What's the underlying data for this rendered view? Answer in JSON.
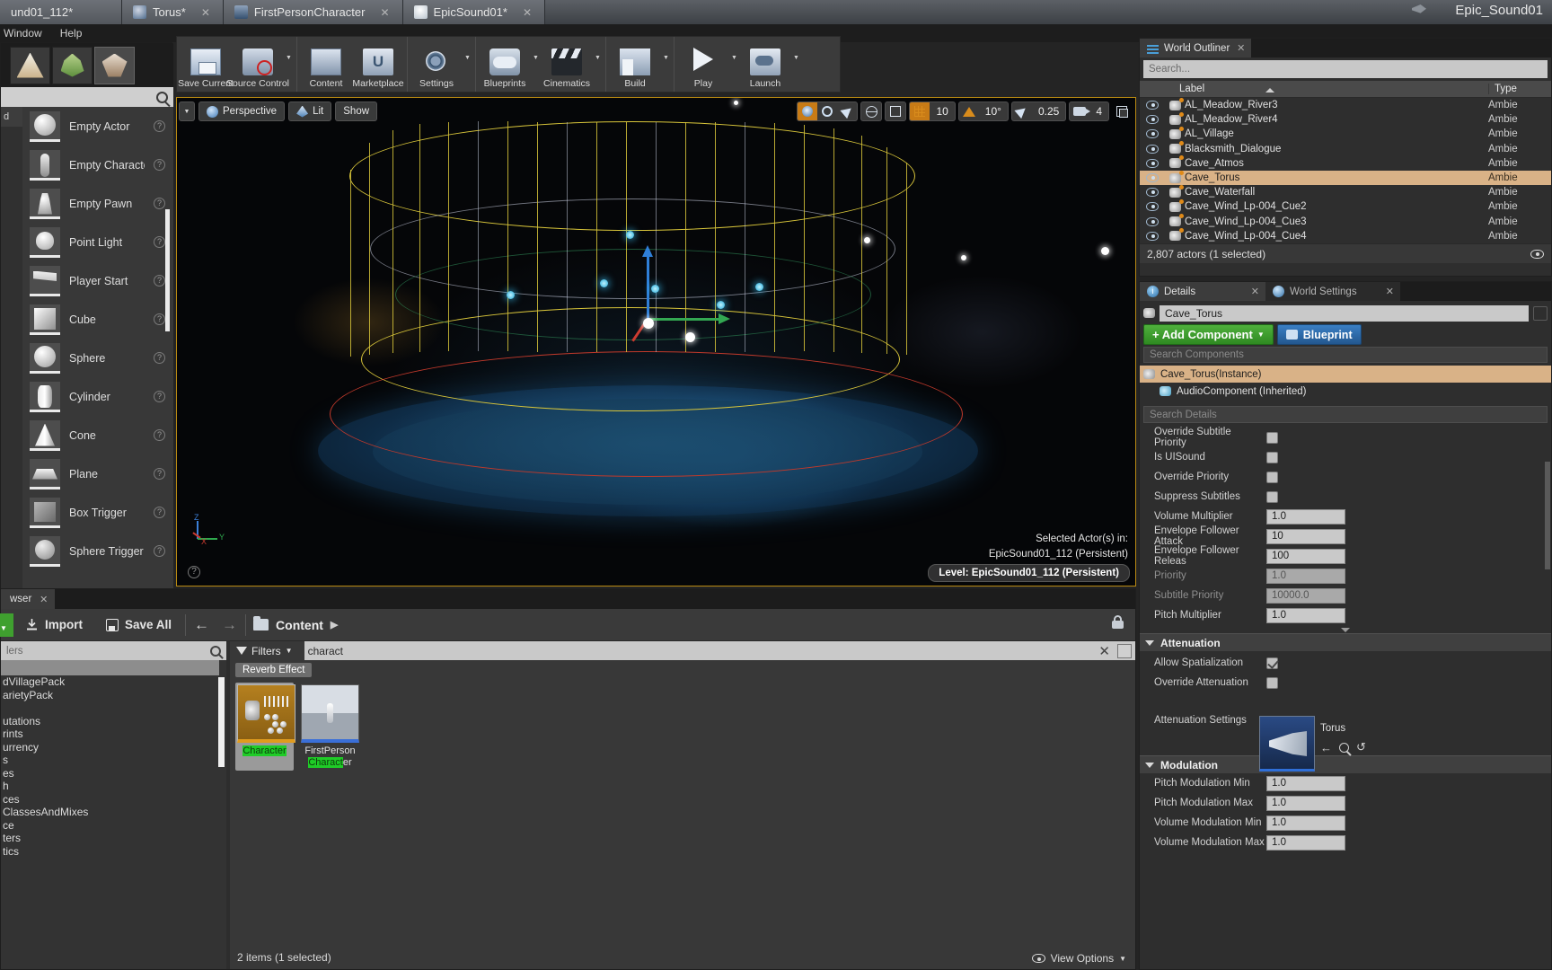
{
  "window": {
    "tabs": [
      {
        "label": "und01_112*",
        "icon": "level-icon",
        "closable": false
      },
      {
        "label": "Torus*",
        "icon": "torus-icon",
        "closable": true
      },
      {
        "label": "FirstPersonCharacter",
        "icon": "character-icon",
        "closable": true
      },
      {
        "label": "EpicSound01*",
        "icon": "sound-icon",
        "closable": true
      }
    ],
    "app_title": "Epic_Sound01"
  },
  "menubar": {
    "items": [
      "Window",
      "Help"
    ]
  },
  "toolbar": {
    "groups": [
      {
        "buttons": [
          {
            "label": "Save Current",
            "icon": "save-icon",
            "dropdown": false
          },
          {
            "label": "Source Control",
            "icon": "source-control-icon",
            "dropdown": true
          }
        ]
      },
      {
        "buttons": [
          {
            "label": "Content",
            "icon": "content-icon",
            "dropdown": false
          },
          {
            "label": "Marketplace",
            "icon": "marketplace-icon",
            "dropdown": false
          }
        ]
      },
      {
        "buttons": [
          {
            "label": "Settings",
            "icon": "settings-gear-icon",
            "dropdown": true
          }
        ]
      },
      {
        "buttons": [
          {
            "label": "Blueprints",
            "icon": "blueprints-icon",
            "dropdown": true
          },
          {
            "label": "Cinematics",
            "icon": "cinematics-icon",
            "dropdown": true
          }
        ]
      },
      {
        "buttons": [
          {
            "label": "Build",
            "icon": "build-icon",
            "dropdown": true
          }
        ]
      },
      {
        "buttons": [
          {
            "label": "Play",
            "icon": "play-icon",
            "dropdown": true
          },
          {
            "label": "Launch",
            "icon": "launch-icon",
            "dropdown": true
          }
        ]
      }
    ]
  },
  "place_actors": {
    "search_placeholder": "",
    "category_label": "d",
    "items": [
      {
        "label": "Empty Actor",
        "icon": "sphere-thumb"
      },
      {
        "label": "Empty Character",
        "icon": "character-thumb"
      },
      {
        "label": "Empty Pawn",
        "icon": "pawn-thumb"
      },
      {
        "label": "Point Light",
        "icon": "bulb-thumb"
      },
      {
        "label": "Player Start",
        "icon": "flag-thumb"
      },
      {
        "label": "Cube",
        "icon": "cube-thumb"
      },
      {
        "label": "Sphere",
        "icon": "sphere-thumb"
      },
      {
        "label": "Cylinder",
        "icon": "cylinder-thumb"
      },
      {
        "label": "Cone",
        "icon": "cone-thumb"
      },
      {
        "label": "Plane",
        "icon": "plane-thumb"
      },
      {
        "label": "Box Trigger",
        "icon": "box-trigger-thumb"
      },
      {
        "label": "Sphere Trigger",
        "icon": "sphere-trigger-thumb"
      }
    ]
  },
  "viewport": {
    "perspective_label": "Perspective",
    "view_mode_label": "Lit",
    "show_label": "Show",
    "grid_snap_value": "10",
    "rotation_snap_value": "10°",
    "scale_snap_value": "0.25",
    "camera_speed_value": "4",
    "overlay_line1": "Selected Actor(s) in:",
    "overlay_line2": "EpicSound01_112 (Persistent)",
    "level_chip": "Level:  EpicSound01_112 (Persistent)",
    "axis_labels": {
      "x": "X",
      "y": "Y",
      "z": "Z"
    }
  },
  "outliner": {
    "title": "World Outliner",
    "search_placeholder": "Search...",
    "columns": [
      "Label",
      "Type"
    ],
    "rows": [
      {
        "label": "AL_Meadow_River3",
        "type": "Ambie",
        "selected": false
      },
      {
        "label": "AL_Meadow_River4",
        "type": "Ambie",
        "selected": false
      },
      {
        "label": "AL_Village",
        "type": "Ambie",
        "selected": false
      },
      {
        "label": "Blacksmith_Dialogue",
        "type": "Ambie",
        "selected": false
      },
      {
        "label": "Cave_Atmos",
        "type": "Ambie",
        "selected": false
      },
      {
        "label": "Cave_Torus",
        "type": "Ambie",
        "selected": true
      },
      {
        "label": "Cave_Waterfall",
        "type": "Ambie",
        "selected": false
      },
      {
        "label": "Cave_Wind_Lp-004_Cue2",
        "type": "Ambie",
        "selected": false
      },
      {
        "label": "Cave_Wind_Lp-004_Cue3",
        "type": "Ambie",
        "selected": false
      },
      {
        "label": "Cave_Wind_Lp-004_Cue4",
        "type": "Ambie",
        "selected": false
      }
    ],
    "status": "2,807 actors (1 selected)"
  },
  "details": {
    "tab_title": "Details",
    "world_settings_tab": "World Settings",
    "actor_name": "Cave_Torus",
    "add_component_label": "+ Add Component",
    "blueprint_label": "Blueprint",
    "search_components_placeholder": "Search Components",
    "components": [
      {
        "label": "Cave_Torus(Instance)",
        "selected": true,
        "indent": false
      },
      {
        "label": "AudioComponent (Inherited)",
        "selected": false,
        "indent": true
      }
    ],
    "search_details_placeholder": "Search Details",
    "properties": [
      {
        "label": "Override Subtitle Priority",
        "type": "checkbox",
        "value": false,
        "disabled": false
      },
      {
        "label": "Is UISound",
        "type": "checkbox",
        "value": false,
        "disabled": false
      },
      {
        "label": "Override Priority",
        "type": "checkbox",
        "value": false,
        "disabled": false
      },
      {
        "label": "Suppress Subtitles",
        "type": "checkbox",
        "value": false,
        "disabled": false
      },
      {
        "label": "Volume Multiplier",
        "type": "number",
        "value": "1.0",
        "disabled": false
      },
      {
        "label": "Envelope Follower Attack",
        "type": "number",
        "value": "10",
        "disabled": false
      },
      {
        "label": "Envelope Follower Releas",
        "type": "number",
        "value": "100",
        "disabled": false
      },
      {
        "label": "Priority",
        "type": "number",
        "value": "1.0",
        "disabled": true
      },
      {
        "label": "Subtitle Priority",
        "type": "number",
        "value": "10000.0",
        "disabled": true
      },
      {
        "label": "Pitch Multiplier",
        "type": "number",
        "value": "1.0",
        "disabled": false
      }
    ],
    "attenuation": {
      "title": "Attenuation",
      "allow_spatialization_label": "Allow Spatialization",
      "allow_spatialization_value": true,
      "override_attenuation_label": "Override Attenuation",
      "override_attenuation_value": false,
      "attenuation_settings_label": "Attenuation Settings",
      "asset_name": "Torus"
    },
    "modulation": {
      "title": "Modulation",
      "rows": [
        {
          "label": "Pitch Modulation Min",
          "value": "1.0"
        },
        {
          "label": "Pitch Modulation Max",
          "value": "1.0"
        },
        {
          "label": "Volume Modulation Min",
          "value": "1.0"
        },
        {
          "label": "Volume Modulation Max",
          "value": "1.0"
        }
      ]
    }
  },
  "content_browser": {
    "tab_label": "wser",
    "import_label": "Import",
    "save_all_label": "Save All",
    "breadcrumb": "Content",
    "folder_search_placeholder": "lers",
    "tree_items": [
      "dVillagePack",
      "arietyPack",
      "",
      "utations",
      "rints",
      "urrency",
      "s",
      "es",
      "h",
      "ces",
      "ClassesAndMixes",
      "ce",
      "ters",
      "tics"
    ],
    "filters_label": "Filters",
    "search_value": "charact",
    "filter_chip": "Reverb Effect",
    "assets": [
      {
        "name": "Character",
        "highlight": "Character",
        "selected": true,
        "kind": "sound-cue"
      },
      {
        "name": "FirstPerson Character",
        "line1": "FirstPerson",
        "line2_plain": "",
        "highlight": "Charact",
        "suffix": "er",
        "selected": false,
        "kind": "blueprint"
      }
    ],
    "status": "2 items (1 selected)",
    "view_options_label": "View Options"
  },
  "colors": {
    "accent_orange": "#d9b287",
    "green_button": "#3fa02f",
    "blue_button": "#2f6fa8",
    "viewport_border": "#b98a12",
    "highlight_green": "#1fcc27"
  }
}
